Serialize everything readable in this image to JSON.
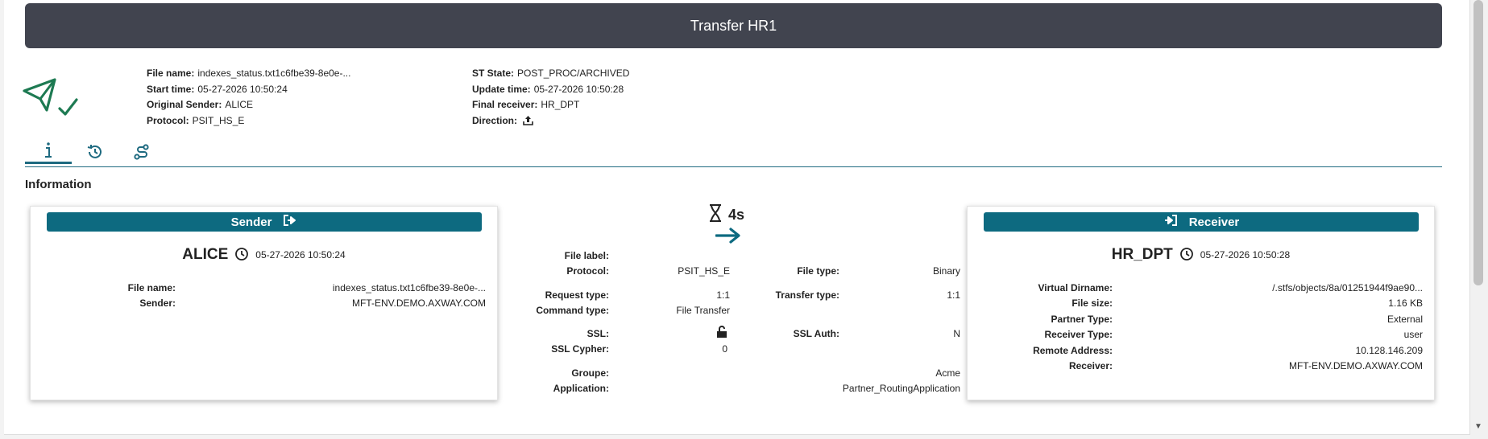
{
  "title": "Transfer HR1",
  "summary": {
    "file_name_label": "File name:",
    "file_name": "indexes_status.txt1c6fbe39-8e0e-...",
    "start_time_label": "Start time:",
    "start_time": "05-27-2026 10:50:24",
    "original_sender_label": "Original Sender:",
    "original_sender": "ALICE",
    "protocol_label": "Protocol:",
    "protocol": "PSIT_HS_E",
    "st_state_label": "ST State:",
    "st_state": "POST_PROC/ARCHIVED",
    "update_time_label": "Update time:",
    "update_time": "05-27-2026 10:50:28",
    "final_receiver_label": "Final receiver:",
    "final_receiver": "HR_DPT",
    "direction_label": "Direction:",
    "direction_icon": "upload-icon"
  },
  "tabs": [
    {
      "icon": "info-icon",
      "active": true
    },
    {
      "icon": "history-icon",
      "active": false
    },
    {
      "icon": "route-icon",
      "active": false
    }
  ],
  "section_title": "Information",
  "sender": {
    "header": "Sender",
    "name": "ALICE",
    "datetime": "05-27-2026 10:50:24",
    "fields": [
      {
        "label": "File name:",
        "value": "indexes_status.txt1c6fbe39-8e0e-..."
      },
      {
        "label": "Sender:",
        "value": "MFT-ENV.DEMO.AXWAY.COM"
      }
    ]
  },
  "receiver": {
    "header": "Receiver",
    "name": "HR_DPT",
    "datetime": "05-27-2026 10:50:28",
    "fields": [
      {
        "label": "Virtual Dirname:",
        "value": "/.stfs/objects/8a/01251944f9ae90..."
      },
      {
        "label": "File size:",
        "value": "1.16 KB"
      },
      {
        "label": "Partner Type:",
        "value": "External"
      },
      {
        "label": "Receiver Type:",
        "value": "user"
      },
      {
        "label": "Remote Address:",
        "value": "10.128.146.209"
      },
      {
        "label": "Receiver:",
        "value": "MFT-ENV.DEMO.AXWAY.COM"
      }
    ]
  },
  "transfer": {
    "duration": "4s",
    "file_label_label": "File label:",
    "file_label": "",
    "protocol_label": "Protocol:",
    "protocol": "PSIT_HS_E",
    "file_type_label": "File type:",
    "file_type": "Binary",
    "request_type_label": "Request type:",
    "request_type": "1:1",
    "transfer_type_label": "Transfer type:",
    "transfer_type": "1:1",
    "command_type_label": "Command type:",
    "command_type": "File Transfer",
    "ssl_label": "SSL:",
    "ssl_icon": "unlock-icon",
    "ssl_auth_label": "SSL Auth:",
    "ssl_auth": "N",
    "ssl_cypher_label": "SSL Cypher:",
    "ssl_cypher": "0",
    "groupe_label": "Groupe:",
    "groupe": "Acme",
    "application_label": "Application:",
    "application": "Partner_RoutingApplication"
  },
  "colors": {
    "title_bar": "#41444f",
    "accent": "#0d6a80",
    "success": "#1d7a52"
  }
}
